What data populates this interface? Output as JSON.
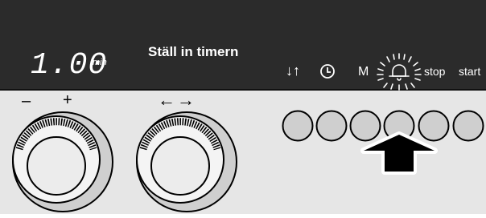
{
  "display": {
    "time_value": "1.00",
    "time_unit": "min",
    "instruction": "Ställ in timern"
  },
  "left_knob": {
    "minus_label": "–",
    "plus_label": "+"
  },
  "right_knob": {
    "arrows_label": "←→"
  },
  "function_bar": {
    "temp_label": "↓↑",
    "clock_icon": "clock-icon",
    "memory_label": "M",
    "timer_icon": "bell-icon",
    "stop_label": "stop",
    "start_label": "start",
    "highlighted": "timer"
  },
  "buttons": {
    "count": 6,
    "indicated_index": 3
  },
  "colors": {
    "panel_dark": "#2b2b2b",
    "panel_light": "#e6e6e6",
    "text": "#ffffff",
    "pointer": "#000000"
  }
}
